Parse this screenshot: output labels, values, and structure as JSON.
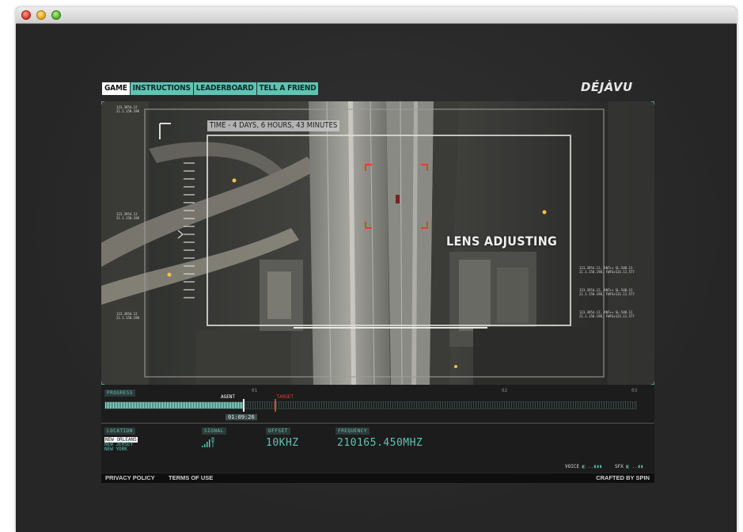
{
  "nav": {
    "items": [
      {
        "label": "GAME",
        "active": true
      },
      {
        "label": "INSTRUCTIONS",
        "active": false
      },
      {
        "label": "LEADERBOARD",
        "active": false
      },
      {
        "label": "TELL A FRIEND",
        "active": false
      }
    ]
  },
  "logo": "DÉJÀVU",
  "viewport": {
    "time_banner": "TIME - 4 DAYS, 6 HOURS, 43 MINUTES",
    "status": "LENS ADJUSTING",
    "left_readouts": [
      "123.3954.12\n21.1.158.198",
      "123.3954.12\n21.1.158.198",
      "123.3954.12\n21.1.158.198"
    ],
    "right_readouts": [
      "123.3954.12, ANT++ SL-548.11\n21.1.158.198, FWFG+131.11.577",
      "123.3954.12, ANT++ SL-548.11\n21.1.158.198, FWFG+131.11.577",
      "123.3954.12, ANT++ SL-548.11\n21.1.158.198, FWFG+131.11.577"
    ]
  },
  "progress": {
    "label": "PROGRESS",
    "agent_label": "AGENT",
    "target_label": "TARGET",
    "elapsed": "01:09:26",
    "ticks": [
      "01",
      "02",
      "03"
    ],
    "agent_fraction": 0.26,
    "target_fraction": 0.32
  },
  "info": {
    "location_label": "LOCATION",
    "signal_label": "SIGNAL",
    "offset_label": "OFFSET",
    "frequency_label": "FREQUENCY",
    "locations": [
      {
        "name": "NEW ORLEANS",
        "selected": true
      },
      {
        "name": "NEW JERSEY",
        "selected": false
      },
      {
        "name": "NEW YORK",
        "selected": false
      }
    ],
    "offset_value": "10KHZ",
    "frequency_value": "210165.450MHZ"
  },
  "audio": {
    "voice_label": "VOICE",
    "sfx_label": "SFX"
  },
  "footer": {
    "privacy": "PRIVACY POLICY",
    "terms": "TERMS OF USE",
    "credit": "CRAFTED BY SPIN"
  },
  "colors": {
    "accent": "#5fc4b3",
    "target": "#e0402a",
    "panel": "#1c1c1c"
  }
}
